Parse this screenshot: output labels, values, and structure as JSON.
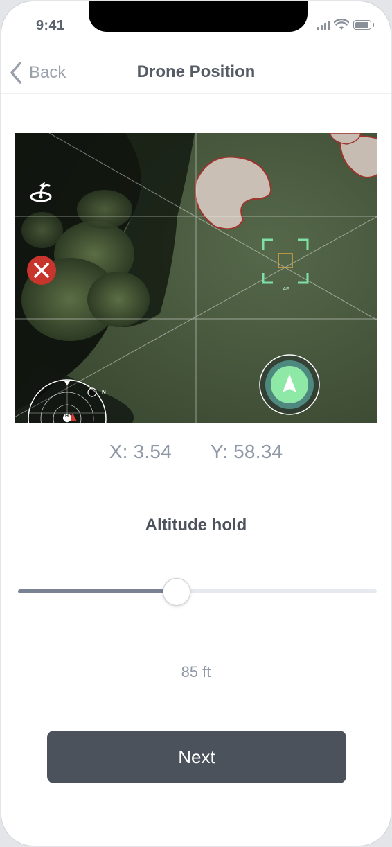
{
  "status_bar": {
    "time": "9:41"
  },
  "nav": {
    "back_label": "Back",
    "title": "Drone Position"
  },
  "camera": {
    "icons": [
      "return-home-icon",
      "cancel-icon",
      "focus-frame-icon",
      "compass-radar-icon",
      "navigate-arrow-icon"
    ],
    "focus_label": "AF",
    "compass_north": "N",
    "compass_home": "H",
    "colors": {
      "cancel": "#c8352c",
      "focus_frame": "#7fe0a6",
      "navigate": "#8ee8a6"
    }
  },
  "position": {
    "x_text": "X: 3.54",
    "y_text": "Y: 58.34"
  },
  "altitude": {
    "title": "Altitude hold",
    "value_text": "85 ft",
    "slider_fraction": 0.44
  },
  "actions": {
    "next_label": "Next"
  },
  "colors": {
    "primary_button": "#4b525c",
    "slider_fill": "#7a8394"
  }
}
